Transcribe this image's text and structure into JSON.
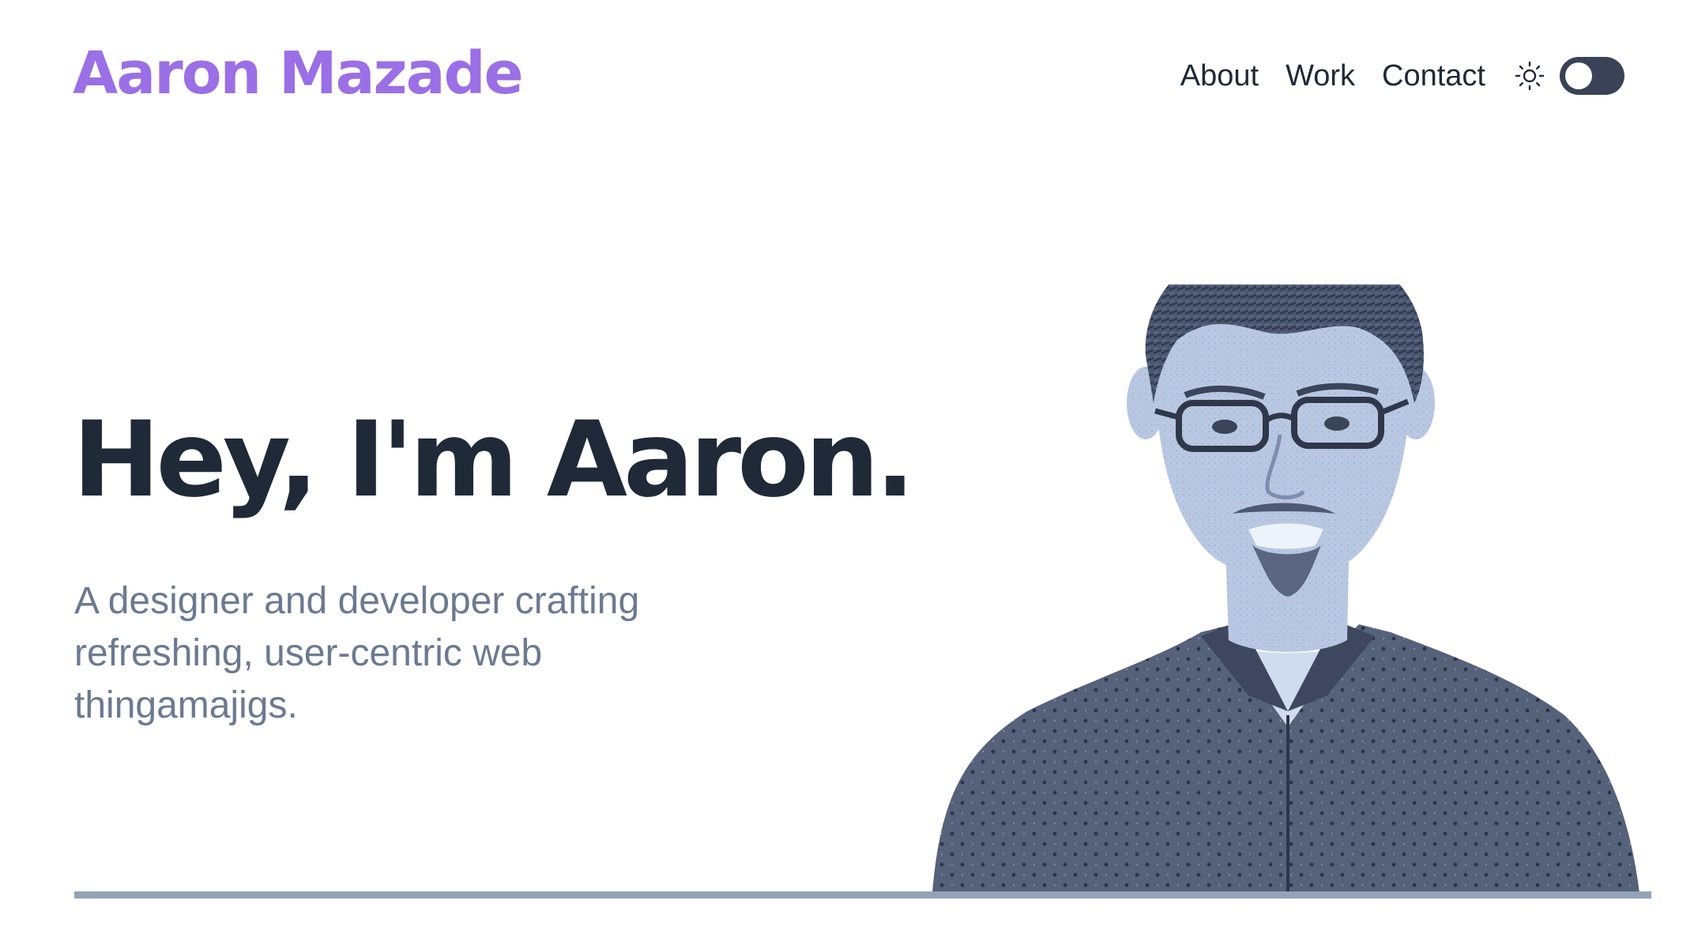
{
  "header": {
    "brand": "Aaron Mazade",
    "nav": {
      "about": "About",
      "work": "Work",
      "contact": "Contact"
    },
    "theme_icon": "sun-icon",
    "theme_toggle_state": "off"
  },
  "hero": {
    "title": "Hey, I'm Aaron.",
    "subtitle": "A designer and developer crafting refreshing, user-centric web thingamajigs.",
    "portrait_icon": "portrait-photo"
  },
  "colors": {
    "brand": "#9b6fe6",
    "heading": "#1f2937",
    "subtitle": "#6b7a91",
    "toggle": "#394256",
    "portrait_tint": "#a9bcda",
    "divider": "#94a3b8"
  }
}
